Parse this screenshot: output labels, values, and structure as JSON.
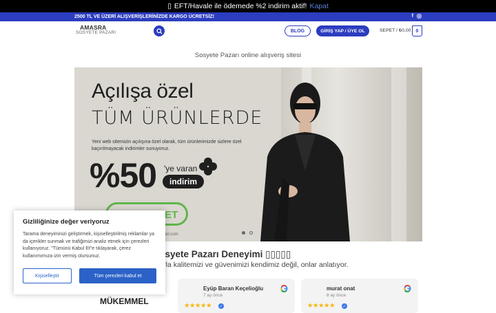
{
  "notice": {
    "text": "EFT/Havale ile ödemede %2 indirim aktif!",
    "close_label": "Kapat"
  },
  "promo": {
    "text": "2500 TL VE ÜZERİ ALIŞVERİŞLERİNİZDE KARGO ÜCRETSİZ!"
  },
  "header": {
    "logo_line1": "AMASRA",
    "logo_line2": "SOSYETE PAZARI",
    "blog_label": "BLOG",
    "login_label": "GİRİŞ YAP / ÜYE OL",
    "cart_label": "SEPET / ₺0,00",
    "cart_count": "0"
  },
  "tagline": "Sosyete Pazarı online alışveriş sitesi",
  "hero": {
    "line1": "Açılışa özel",
    "line2": "TÜM ÜRÜNLERDE",
    "desc": "Yeni web sitemizin açılışına özel olarak, tüm ürünlerimizde sizlere özel kaçırılmayacak indirimler sunuyoruz.",
    "percent": "%50",
    "ye_varan": "'ye varan",
    "indirim": "indirim",
    "pill_text": "FSET",
    "site_url": "zari.com"
  },
  "section": {
    "title": "rkiye’nin Sosyete Pazarı Deneyimi ",
    "subtitle": "oogle yorumlarıyla kalitemizi ve güvenimizi kendimiz değil, onlar anlatıyor.",
    "rating_label": "MÜKEMMEL"
  },
  "reviews": [
    {
      "name": "Eyüp Baran Keçelioğlu",
      "date": "7 ay önce",
      "stars": "★★★★★"
    },
    {
      "name": "murat onat",
      "date": "8 ay önce",
      "stars": "★★★★★"
    }
  ],
  "cookie": {
    "title": "Gizliliğinize değer veriyoruz",
    "body": "Tarama deneyiminizi geliştirmek, kişiselleştirilmiş reklamlar ya da içerikler sunmak ve trafiğimizi analiz etmek için çerezleri kullanıyoruz. \"Tümünü Kabul Et\"e tıklayarak, çerez kullanımımıza izin vermiş olursunuz.",
    "customize_label": "Kişiselleştir",
    "accept_label": "Tüm çerezleri kabul et"
  },
  "colors": {
    "brand_blue": "#2c3dbf",
    "cookie_blue": "#2c62c7",
    "star": "#f5b70a",
    "pill_green": "#5fb54a"
  },
  "icons": [
    "search-icon",
    "facebook-icon",
    "instagram-icon",
    "google-icon",
    "verified-icon",
    "clover-icon"
  ]
}
